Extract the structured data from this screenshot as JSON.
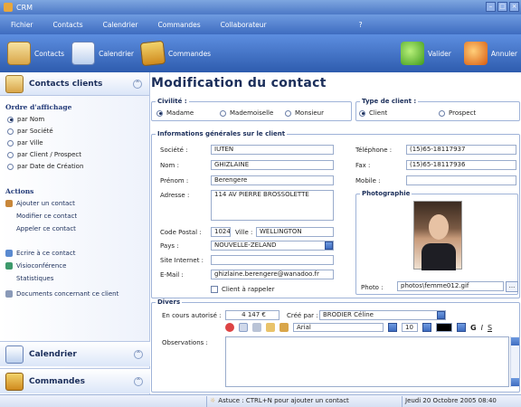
{
  "window": {
    "title": "CRM"
  },
  "menu": [
    "Fichier",
    "Contacts",
    "Calendrier",
    "Commandes",
    "Collaborateur",
    "?"
  ],
  "toolbar": {
    "contacts": "Contacts",
    "calendrier": "Calendrier",
    "commandes": "Commandes",
    "valider": "Valider",
    "annuler": "Annuler"
  },
  "sidebar": {
    "header": "Contacts clients",
    "order_title": "Ordre d'affichage",
    "order_options": [
      "par Nom",
      "par Société",
      "par Ville",
      "par Client / Prospect",
      "par Date de Création"
    ],
    "order_selected": "par Nom",
    "actions_title": "Actions",
    "actions": [
      "Ajouter un contact",
      "Modifier ce contact",
      "Appeler ce contact",
      "Ecrire à ce contact",
      "Visioconférence",
      "Statistiques",
      "Documents concernant ce client"
    ],
    "calendar": "Calendrier",
    "orders": "Commandes"
  },
  "form": {
    "title": "Modification du contact",
    "civilite": {
      "legend": "Civilité :",
      "options": [
        "Madame",
        "Mademoiselle",
        "Monsieur"
      ],
      "selected": "Madame"
    },
    "type_client": {
      "legend": "Type de client :",
      "options": [
        "Client",
        "Prospect"
      ],
      "selected": "Client"
    },
    "general": {
      "legend": "Informations générales sur le client",
      "societe_label": "Société :",
      "societe": "IUTEN",
      "nom_label": "Nom :",
      "nom": "GHIZLAINE",
      "prenom_label": "Prénom :",
      "prenom": "Berengere",
      "adresse_label": "Adresse :",
      "adresse": "114 AV PIERRE BROSSOLETTE",
      "cp_label": "Code Postal :",
      "cp": "1024",
      "ville_label": "Ville :",
      "ville": "WELLINGTON",
      "pays_label": "Pays :",
      "pays": "NOUVELLE-ZELAND",
      "site_label": "Site Internet :",
      "site": "",
      "email_label": "E-Mail :",
      "email": "ghizlaine.berengere@wanadoo.fr",
      "rappel_label": "Client à rappeler",
      "tel_label": "Téléphone :",
      "tel": "(15)65-18117937",
      "fax_label": "Fax :",
      "fax": "(15)65-18117936",
      "mobile_label": "Mobile :",
      "mobile": "",
      "photo_legend": "Photographie",
      "photo_label": "Photo :",
      "photo": "photos\\femme012.gif",
      "browse": "..."
    },
    "divers": {
      "legend": "Divers",
      "encours_label": "En cours autorisé :",
      "encours": "4 147 €",
      "cree_label": "Créé par :",
      "cree": "BRODIER Céline",
      "font": "Arial",
      "size": "10",
      "bold": "G",
      "italic": "I",
      "underline": "S",
      "obs_label": "Observations :"
    }
  },
  "status": {
    "tip": "Astuce : CTRL+N pour ajouter un contact",
    "date": "Jeudi 20 Octobre 2005 08:40"
  }
}
